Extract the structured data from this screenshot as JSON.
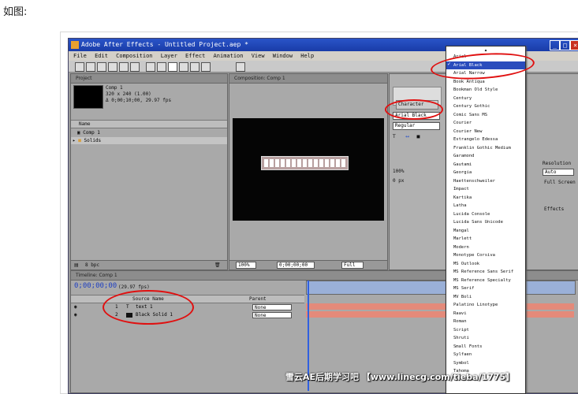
{
  "caption": "如图:",
  "window": {
    "title": "Adobe After Effects - Untitled Project.aep *",
    "menus": [
      "File",
      "Edit",
      "Composition",
      "Layer",
      "Effect",
      "Animation",
      "View",
      "Window",
      "Help"
    ]
  },
  "project_panel": {
    "tab": "Project",
    "comp_name": "Comp 1",
    "comp_info_1": "320 x 240 (1.00)",
    "comp_info_2": "Δ 0;00;10;00, 29.97 fps",
    "column_name": "Name",
    "items": [
      "Comp 1",
      "Solids"
    ],
    "footer": "8 bpc"
  },
  "comp_panel": {
    "tab": "Composition: Comp 1",
    "zoom": "100%",
    "timecode": "0;00;00;00",
    "view": "Full"
  },
  "character_panel": {
    "tab": "Character",
    "font_field": "Arial Black",
    "style_field": "Regular",
    "tracking": "100%",
    "leading": "0 px"
  },
  "right_panel": {
    "resolution_label": "Resolution",
    "resolution_value": "Auto",
    "full_screen": "Full Screen",
    "effects_label": "Effects"
  },
  "timeline": {
    "tab": "Timeline: Comp 1",
    "timecode": "0;00;00;00",
    "fps": "(29.97 fps)",
    "header_source": "Source Name",
    "header_parent": "Parent",
    "layers": [
      {
        "num": "1",
        "name": "text 1",
        "parent": "None"
      },
      {
        "num": "2",
        "name": "Black Solid 1",
        "parent": "None"
      }
    ]
  },
  "font_dropdown": {
    "selected": "Arial Black",
    "items": [
      "Arial",
      "Arial Black",
      "Arial Narrow",
      "Book Antiqua",
      "Bookman Old Style",
      "Century",
      "Century Gothic",
      "Comic Sans MS",
      "Courier",
      "Courier New",
      "Estrangelo Edessa",
      "Franklin Gothic Medium",
      "Garamond",
      "Gautami",
      "Georgia",
      "Haettenschweiler",
      "Impact",
      "Kartika",
      "Latha",
      "Lucida Console",
      "Lucida Sans Unicode",
      "Mangal",
      "Marlett",
      "Modern",
      "Monotype Corsiva",
      "MS Outlook",
      "MS Reference Sans Serif",
      "MS Reference Specialty",
      "MS Serif",
      "MV Boli",
      "Palatino Linotype",
      "Raavi",
      "Roman",
      "Script",
      "Shruti",
      "Small Fonts",
      "Sylfaen",
      "Symbol",
      "Tahoma",
      "Terminal"
    ]
  },
  "watermark": "雪云AE后期学习吧 【www.linecg.com/tieba/1775】",
  "colors": {
    "titlebar": "#1a3ca8",
    "selection": "#2a4cbd",
    "annotation": "#e01010",
    "layer_bar": "#e48a7a"
  }
}
